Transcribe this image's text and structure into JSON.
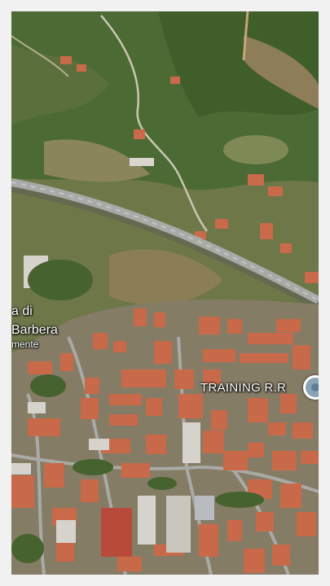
{
  "map": {
    "view": "satellite",
    "place_label_line1": "a di",
    "place_label_line2": "Barbera",
    "place_label_line3": "mente",
    "poi_label": "TRAINING R.R",
    "poi_icon": "location-pin-icon",
    "colors": {
      "vegetation": "#4f6b34",
      "terrain": "#8c8a5c",
      "roofs": "#c96a4a",
      "road": "#9a9d9c",
      "label_text": "#ffffff"
    }
  }
}
